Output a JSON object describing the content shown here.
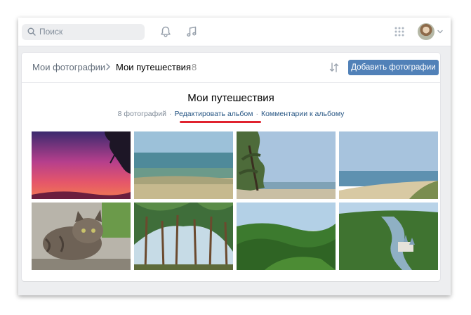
{
  "search": {
    "placeholder": "Поиск"
  },
  "breadcrumb": {
    "root": "Мои фотографии",
    "current": "Мои путешествия",
    "count": "8"
  },
  "toolbar": {
    "add_label": "Добавить фотографии"
  },
  "album": {
    "title": "Мои путешествия",
    "photo_count": "8 фотографий",
    "edit_label": "Редактировать альбом",
    "comments_label": "Комментарии к альбому",
    "separator": "·"
  },
  "photos": [
    {
      "name": "sunset-photo"
    },
    {
      "name": "lake-photo"
    },
    {
      "name": "seashore-tree-photo"
    },
    {
      "name": "beach-photo"
    },
    {
      "name": "cat-photo"
    },
    {
      "name": "pine-forest-photo"
    },
    {
      "name": "green-hills-photo"
    },
    {
      "name": "river-valley-photo"
    }
  ],
  "colors": {
    "accent": "#5181b8",
    "link": "#2a5885",
    "highlight": "#e0232f"
  },
  "icons": [
    "search-icon",
    "bell-icon",
    "music-note-icon",
    "apps-grid-icon",
    "chevron-down-icon",
    "chevron-right-icon",
    "sort-icon"
  ]
}
